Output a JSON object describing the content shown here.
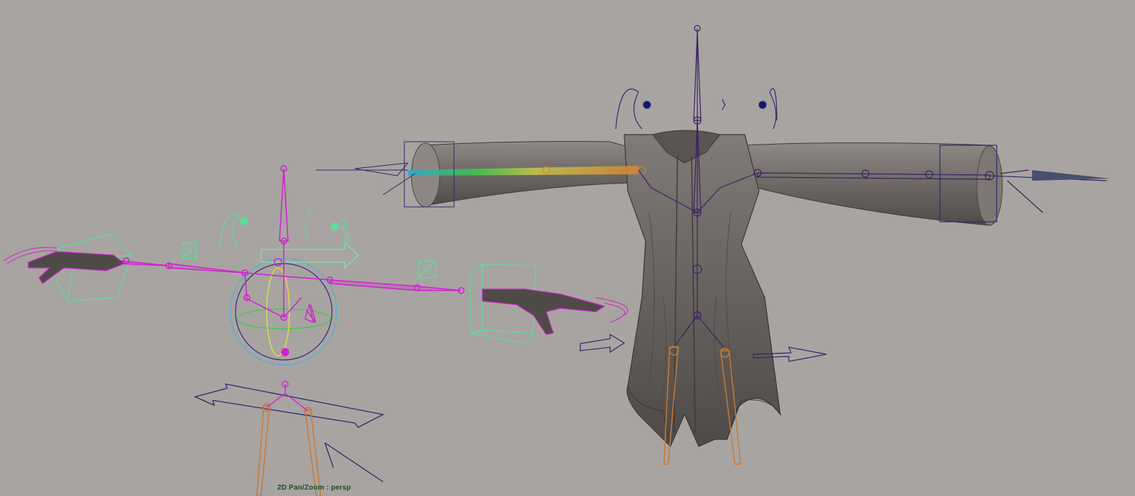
{
  "viewport": {
    "hud_label": "2D Pan/Zoom : persp",
    "camera": "persp",
    "background_color": "#a8a4a1"
  },
  "colors": {
    "rig_magenta": "#d21fd2",
    "control_green": "#7fe3a8",
    "control_blue": "#2b2b6e",
    "leg_orange": "#c77a3a",
    "mesh_grey": "#6f6a66"
  },
  "icons": [
    "translate-arrow-icon",
    "rotate-sphere-icon",
    "ik-handle-icon",
    "box-control-icon"
  ]
}
